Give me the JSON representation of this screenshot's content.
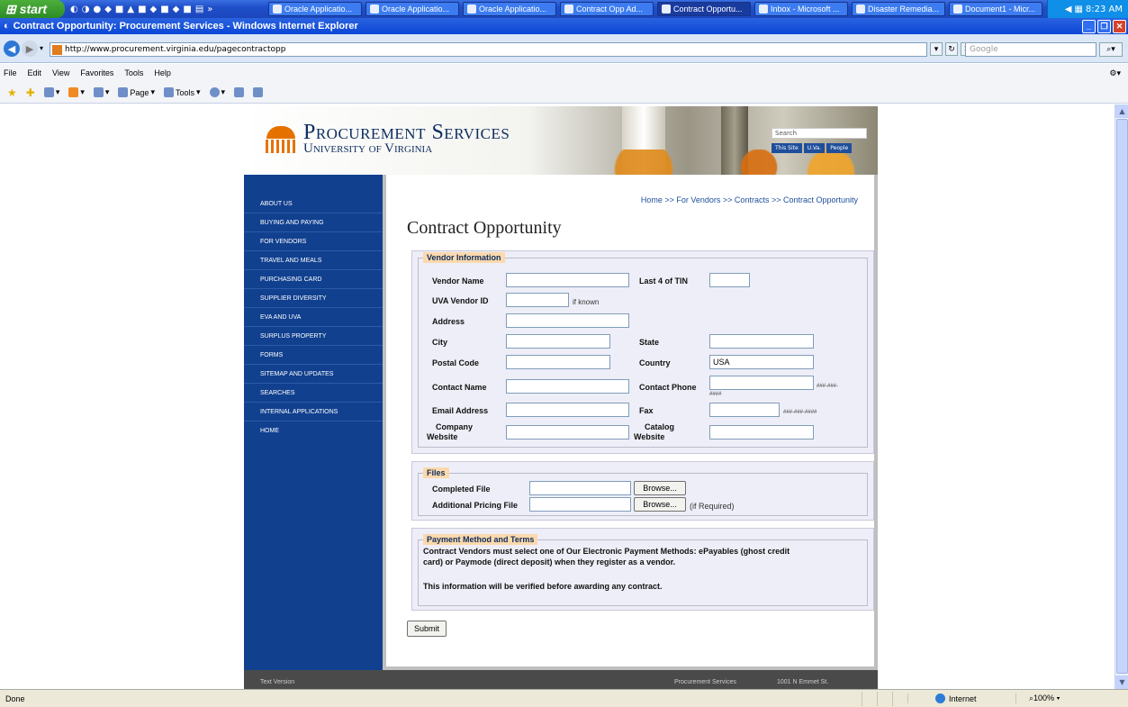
{
  "taskbar": {
    "start_label": "start",
    "buttons": [
      {
        "label": "Oracle Applicatio..."
      },
      {
        "label": "Oracle Applicatio..."
      },
      {
        "label": "Oracle Applicatio..."
      },
      {
        "label": "Contract Opp Ad..."
      },
      {
        "label": "Contract Opportu..."
      },
      {
        "label": "Inbox - Microsoft ..."
      },
      {
        "label": "Disaster Remedia..."
      },
      {
        "label": "Document1 - Micr..."
      }
    ],
    "clock": "8:23 AM"
  },
  "window": {
    "title": "Contract Opportunity: Procurement Services - Windows Internet Explorer"
  },
  "browser": {
    "url": "http://www.procurement.virginia.edu/pagecontractopp",
    "search_placeholder": "Google",
    "menu": [
      "File",
      "Edit",
      "View",
      "Favorites",
      "Tools",
      "Help"
    ],
    "toolbar": {
      "page_label": "Page",
      "tools_label": "Tools"
    },
    "status": {
      "text": "Done",
      "zone": "Internet",
      "zoom": "100%"
    }
  },
  "site": {
    "logo_line1": "Procurement Services",
    "logo_line2": "University of Virginia",
    "search_placeholder": "Search",
    "search_tabs": [
      "This Site",
      "U.Va.",
      "People"
    ],
    "nav": [
      "ABOUT US",
      "BUYING AND PAYING",
      "FOR VENDORS",
      "TRAVEL AND MEALS",
      "PURCHASING CARD",
      "SUPPLIER DIVERSITY",
      "EVA AND UVA",
      "SURPLUS PROPERTY",
      "FORMS",
      "SITEMAP AND UPDATES",
      "SEARCHES",
      "INTERNAL APPLICATIONS",
      "HOME"
    ],
    "breadcrumb": "Home >> For Vendors >> Contracts >> Contract Opportunity",
    "page_title": "Contract Opportunity",
    "vendor_info": {
      "legend": "Vendor Information",
      "vendor_name_label": "Vendor Name",
      "vendor_name_value": "",
      "tin_label": "Last 4 of TIN",
      "tin_value": "",
      "uva_id_label": "UVA Vendor ID",
      "uva_id_value": "",
      "uva_id_hint": "if known",
      "address_label": "Address",
      "address_value": "",
      "city_label": "City",
      "city_value": "",
      "state_label": "State",
      "state_value": "",
      "postal_label": "Postal Code",
      "postal_value": "",
      "country_label": "Country",
      "country_value": "USA",
      "contact_name_label": "Contact Name",
      "contact_name_value": "",
      "contact_phone_label": "Contact Phone",
      "contact_phone_value": "",
      "phone_hint_1": "###-###-",
      "phone_hint_2": "####",
      "email_label": "Email Address",
      "email_value": "",
      "fax_label": "Fax",
      "fax_value": "",
      "fax_hint": "###-###-####",
      "website_label_1": "Company",
      "website_label_2": "Website",
      "website_value": "",
      "catalog_label_1": "Catalog",
      "catalog_label_2": "Website",
      "catalog_value": ""
    },
    "files": {
      "legend": "Files",
      "completed_label": "Completed File",
      "completed_value": "",
      "pricing_label": "Additional Pricing File",
      "pricing_value": "",
      "browse_label": "Browse...",
      "pricing_hint": "(if Required)"
    },
    "payment": {
      "legend": "Payment Method and Terms",
      "text_1": "Contract Vendors must select one of Our Electronic Payment Methods: ePayables (ghost credit",
      "text_2": "card) or Paymode (direct deposit) when they register as a vendor.",
      "text_3": "This information will be verified before awarding any contract."
    },
    "submit_label": "Submit",
    "footer": {
      "left": "Text Version",
      "center": "Procurement Services",
      "right": "1001 N Emmet St."
    }
  }
}
